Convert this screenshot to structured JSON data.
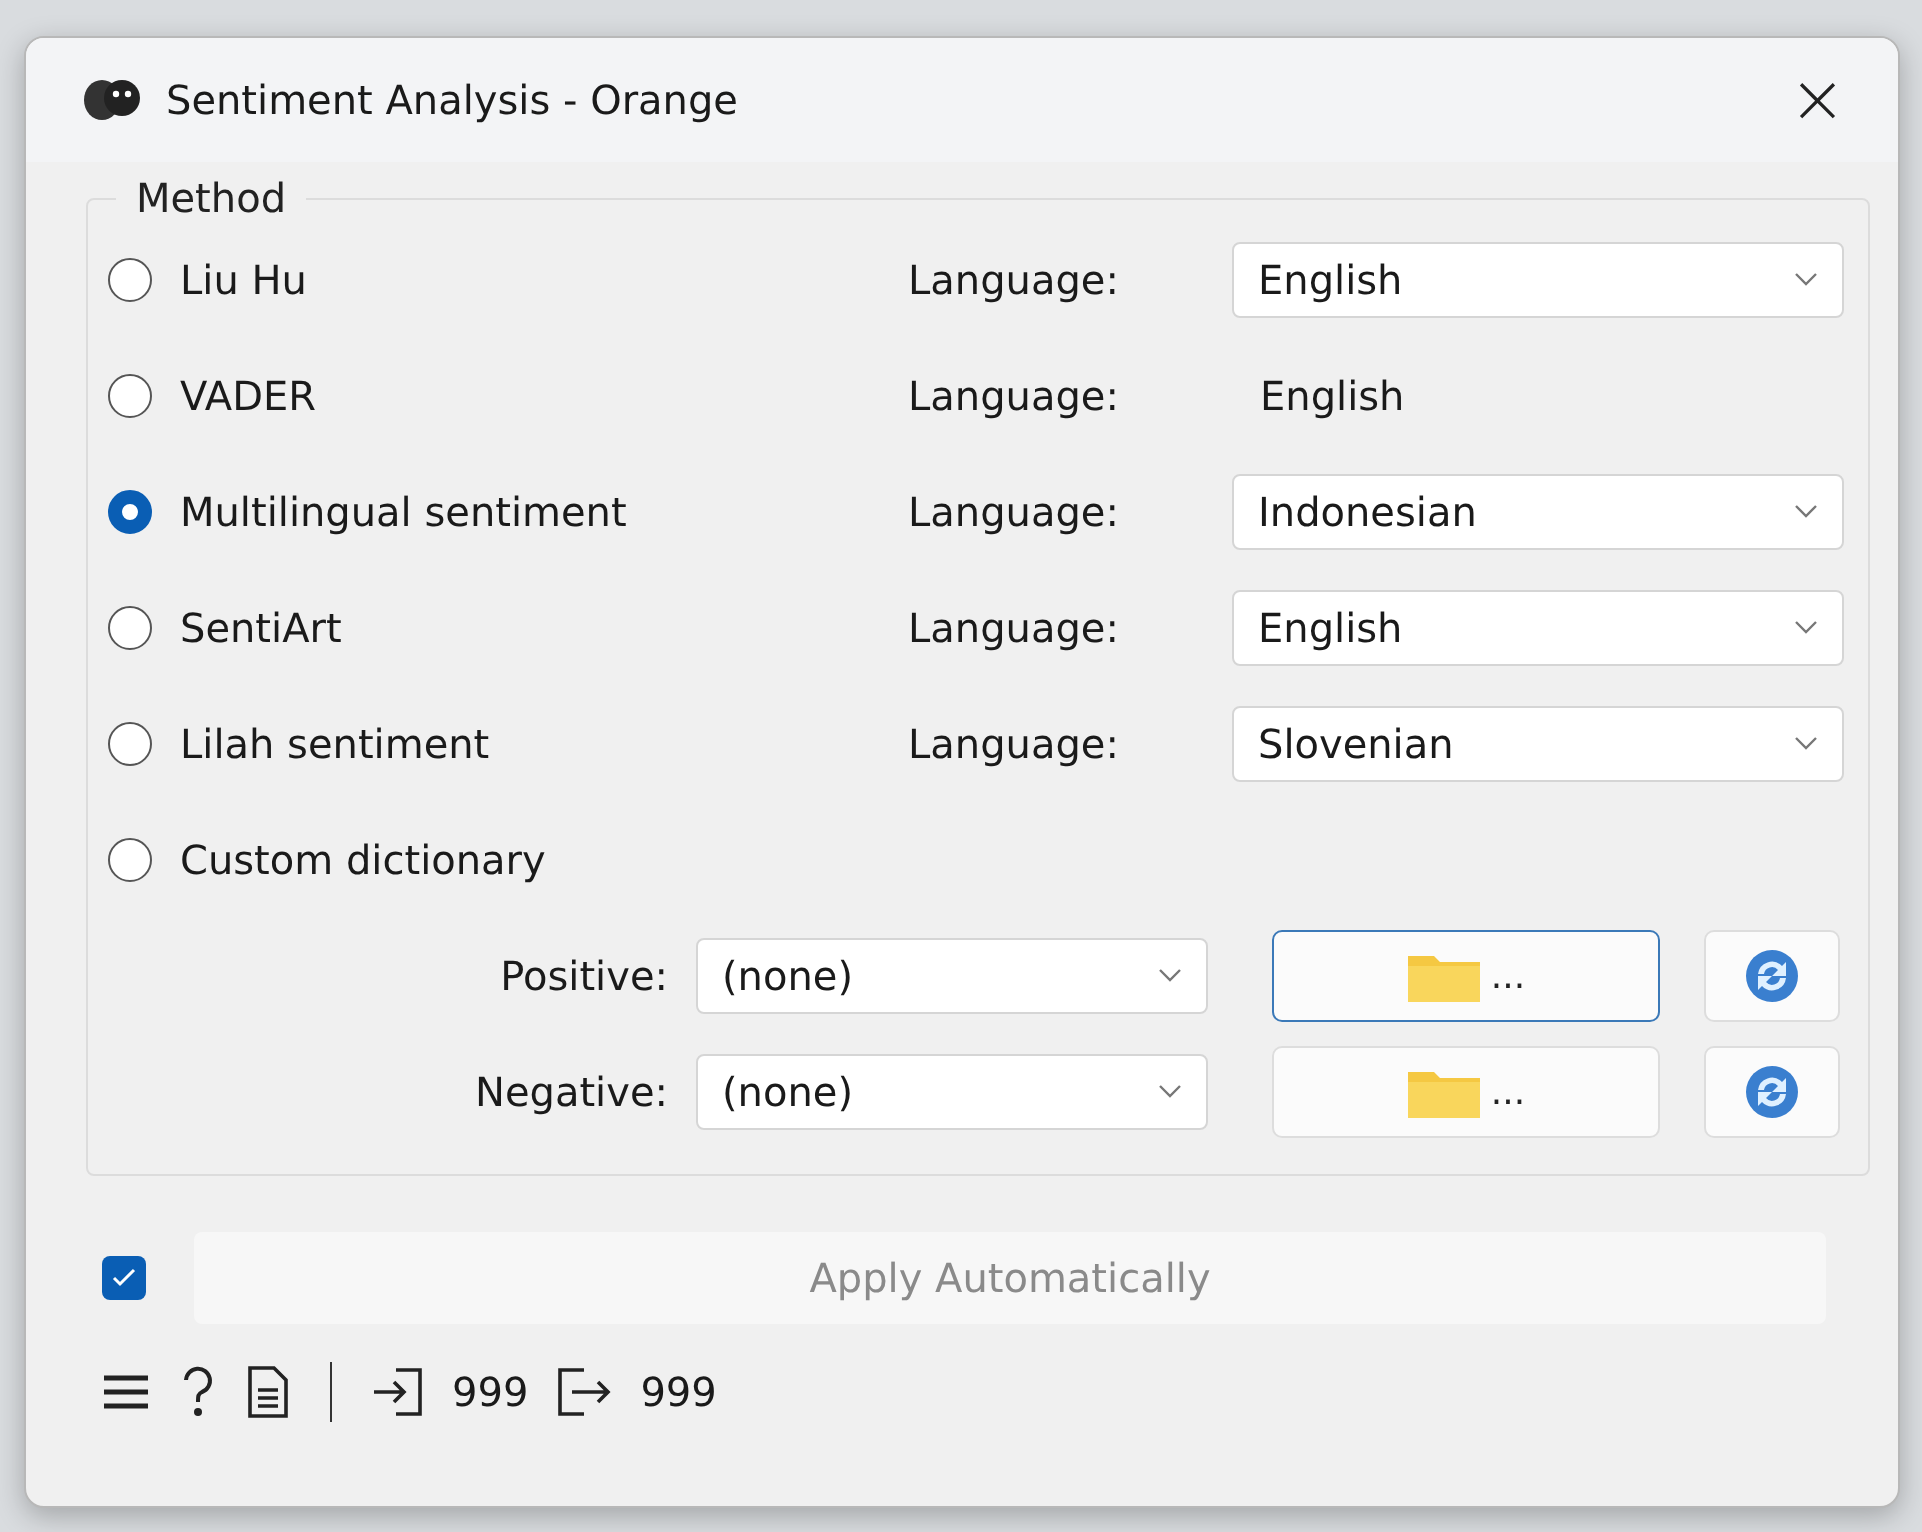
{
  "window": {
    "title": "Sentiment Analysis - Orange",
    "close": "×"
  },
  "method": {
    "title": "Method",
    "options": [
      {
        "label": "Liu Hu",
        "selected": false,
        "language": {
          "kind": "dropdown",
          "label": "Language:",
          "value": "English"
        }
      },
      {
        "label": "VADER",
        "selected": false,
        "language": {
          "kind": "fixed",
          "label": "Language:",
          "value": "English"
        }
      },
      {
        "label": "Multilingual sentiment",
        "selected": true,
        "language": {
          "kind": "dropdown",
          "label": "Language:",
          "value": "Indonesian"
        }
      },
      {
        "label": "SentiArt",
        "selected": false,
        "language": {
          "kind": "dropdown",
          "label": "Language:",
          "value": "English"
        }
      },
      {
        "label": "Lilah sentiment",
        "selected": false,
        "language": {
          "kind": "dropdown",
          "label": "Language:",
          "value": "Slovenian"
        }
      },
      {
        "label": "Custom dictionary",
        "selected": false
      }
    ],
    "dictionaries": [
      {
        "label": "Positive:",
        "value": "(none)",
        "browse": "...",
        "focused": true
      },
      {
        "label": "Negative:",
        "value": "(none)",
        "browse": "...",
        "focused": false
      }
    ]
  },
  "apply": {
    "checked": true,
    "label": "Apply Automatically",
    "disabled": true
  },
  "status_bar": {
    "input_count": "999",
    "output_count": "999"
  }
}
